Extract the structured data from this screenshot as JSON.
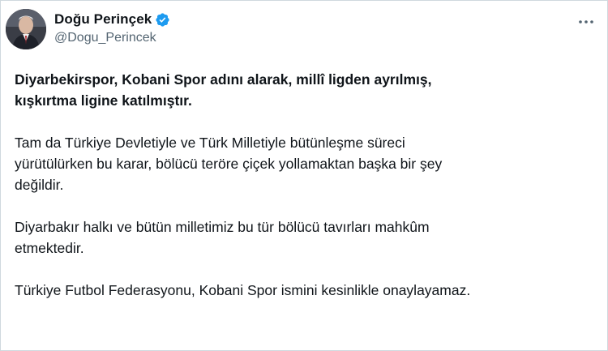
{
  "tweet": {
    "author": {
      "display_name": "Doğu Perinçek",
      "handle": "@Dogu_Perincek",
      "verified": true,
      "verified_color": "#1d9bf0"
    },
    "more_icon": "more-horizontal-icon",
    "paragraphs": [
      {
        "text": "Diyarbekirspor, Kobani Spor adını alarak, millî ligden ayrılmış,\nkışkırtma ligine katılmıştır.",
        "bold": true
      },
      {
        "text": "Tam da Türkiye Devletiyle ve Türk Milletiyle bütünleşme süreci\nyürütülürken bu karar, bölücü teröre çiçek yollamaktan başka bir şey\ndeğildir.",
        "bold": false
      },
      {
        "text": "Diyarbakır halkı ve bütün milletimiz bu tür bölücü tavırları mahkûm\netmektedir.",
        "bold": false
      },
      {
        "text": "Türkiye Futbol Federasyonu, Kobani Spor ismini kesinlikle onaylayamaz.",
        "bold": false
      }
    ]
  }
}
